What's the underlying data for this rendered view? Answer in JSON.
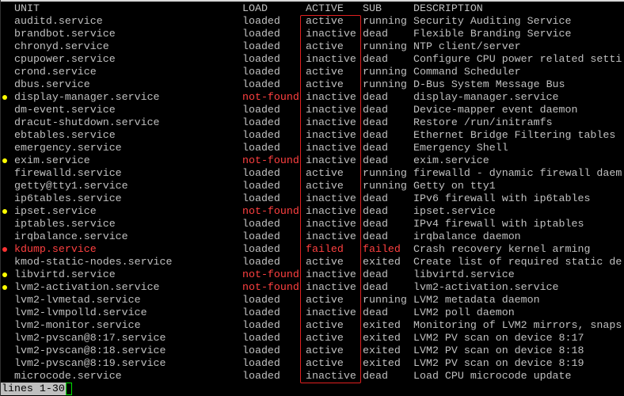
{
  "header": {
    "unit": "UNIT",
    "load": "LOAD",
    "active": "ACTIVE",
    "sub": "SUB",
    "description": "DESCRIPTION"
  },
  "colors": {
    "background": "#000000",
    "text": "#c0c0c0",
    "error": "#ff4040",
    "warning_dot": "#ffff00",
    "failed_dot": "#ff3333",
    "highlight_box": "#e02020",
    "cursor": "#00e000"
  },
  "rows": [
    {
      "bullet": "",
      "unit": "auditd.service",
      "load": "loaded",
      "active": "active",
      "sub": "running",
      "description": "Security Auditing Service"
    },
    {
      "bullet": "",
      "unit": "brandbot.service",
      "load": "loaded",
      "active": "inactive",
      "sub": "dead",
      "description": "Flexible Branding Service"
    },
    {
      "bullet": "",
      "unit": "chronyd.service",
      "load": "loaded",
      "active": "active",
      "sub": "running",
      "description": "NTP client/server"
    },
    {
      "bullet": "",
      "unit": "cpupower.service",
      "load": "loaded",
      "active": "inactive",
      "sub": "dead",
      "description": "Configure CPU power related setti"
    },
    {
      "bullet": "",
      "unit": "crond.service",
      "load": "loaded",
      "active": "active",
      "sub": "running",
      "description": "Command Scheduler"
    },
    {
      "bullet": "",
      "unit": "dbus.service",
      "load": "loaded",
      "active": "active",
      "sub": "running",
      "description": "D-Bus System Message Bus"
    },
    {
      "bullet": "warn",
      "unit": "display-manager.service",
      "load": "not-found",
      "active": "inactive",
      "sub": "dead",
      "description": "display-manager.service"
    },
    {
      "bullet": "",
      "unit": "dm-event.service",
      "load": "loaded",
      "active": "inactive",
      "sub": "dead",
      "description": "Device-mapper event daemon"
    },
    {
      "bullet": "",
      "unit": "dracut-shutdown.service",
      "load": "loaded",
      "active": "inactive",
      "sub": "dead",
      "description": "Restore /run/initramfs"
    },
    {
      "bullet": "",
      "unit": "ebtables.service",
      "load": "loaded",
      "active": "inactive",
      "sub": "dead",
      "description": "Ethernet Bridge Filtering tables"
    },
    {
      "bullet": "",
      "unit": "emergency.service",
      "load": "loaded",
      "active": "inactive",
      "sub": "dead",
      "description": "Emergency Shell"
    },
    {
      "bullet": "warn",
      "unit": "exim.service",
      "load": "not-found",
      "active": "inactive",
      "sub": "dead",
      "description": "exim.service"
    },
    {
      "bullet": "",
      "unit": "firewalld.service",
      "load": "loaded",
      "active": "active",
      "sub": "running",
      "description": "firewalld - dynamic firewall daem"
    },
    {
      "bullet": "",
      "unit": "getty@tty1.service",
      "load": "loaded",
      "active": "active",
      "sub": "running",
      "description": "Getty on tty1"
    },
    {
      "bullet": "",
      "unit": "ip6tables.service",
      "load": "loaded",
      "active": "inactive",
      "sub": "dead",
      "description": "IPv6 firewall with ip6tables"
    },
    {
      "bullet": "warn",
      "unit": "ipset.service",
      "load": "not-found",
      "active": "inactive",
      "sub": "dead",
      "description": "ipset.service"
    },
    {
      "bullet": "",
      "unit": "iptables.service",
      "load": "loaded",
      "active": "inactive",
      "sub": "dead",
      "description": "IPv4 firewall with iptables"
    },
    {
      "bullet": "",
      "unit": "irqbalance.service",
      "load": "loaded",
      "active": "inactive",
      "sub": "dead",
      "description": "irqbalance daemon"
    },
    {
      "bullet": "fail",
      "unit": "kdump.service",
      "load": "loaded",
      "active": "failed",
      "sub": "failed",
      "description": "Crash recovery kernel arming"
    },
    {
      "bullet": "",
      "unit": "kmod-static-nodes.service",
      "load": "loaded",
      "active": "active",
      "sub": "exited",
      "description": "Create list of required static de"
    },
    {
      "bullet": "warn",
      "unit": "libvirtd.service",
      "load": "not-found",
      "active": "inactive",
      "sub": "dead",
      "description": "libvirtd.service"
    },
    {
      "bullet": "warn",
      "unit": "lvm2-activation.service",
      "load": "not-found",
      "active": "inactive",
      "sub": "dead",
      "description": "lvm2-activation.service"
    },
    {
      "bullet": "",
      "unit": "lvm2-lvmetad.service",
      "load": "loaded",
      "active": "active",
      "sub": "running",
      "description": "LVM2 metadata daemon"
    },
    {
      "bullet": "",
      "unit": "lvm2-lvmpolld.service",
      "load": "loaded",
      "active": "inactive",
      "sub": "dead",
      "description": "LVM2 poll daemon"
    },
    {
      "bullet": "",
      "unit": "lvm2-monitor.service",
      "load": "loaded",
      "active": "active",
      "sub": "exited",
      "description": "Monitoring of LVM2 mirrors, snaps"
    },
    {
      "bullet": "",
      "unit": "lvm2-pvscan@8:17.service",
      "load": "loaded",
      "active": "active",
      "sub": "exited",
      "description": "LVM2 PV scan on device 8:17"
    },
    {
      "bullet": "",
      "unit": "lvm2-pvscan@8:18.service",
      "load": "loaded",
      "active": "active",
      "sub": "exited",
      "description": "LVM2 PV scan on device 8:18"
    },
    {
      "bullet": "",
      "unit": "lvm2-pvscan@8:19.service",
      "load": "loaded",
      "active": "active",
      "sub": "exited",
      "description": "LVM2 PV scan on device 8:19"
    },
    {
      "bullet": "",
      "unit": "microcode.service",
      "load": "loaded",
      "active": "inactive",
      "sub": "dead",
      "description": "Load CPU microcode update"
    }
  ],
  "status_line": "lines 1-30"
}
